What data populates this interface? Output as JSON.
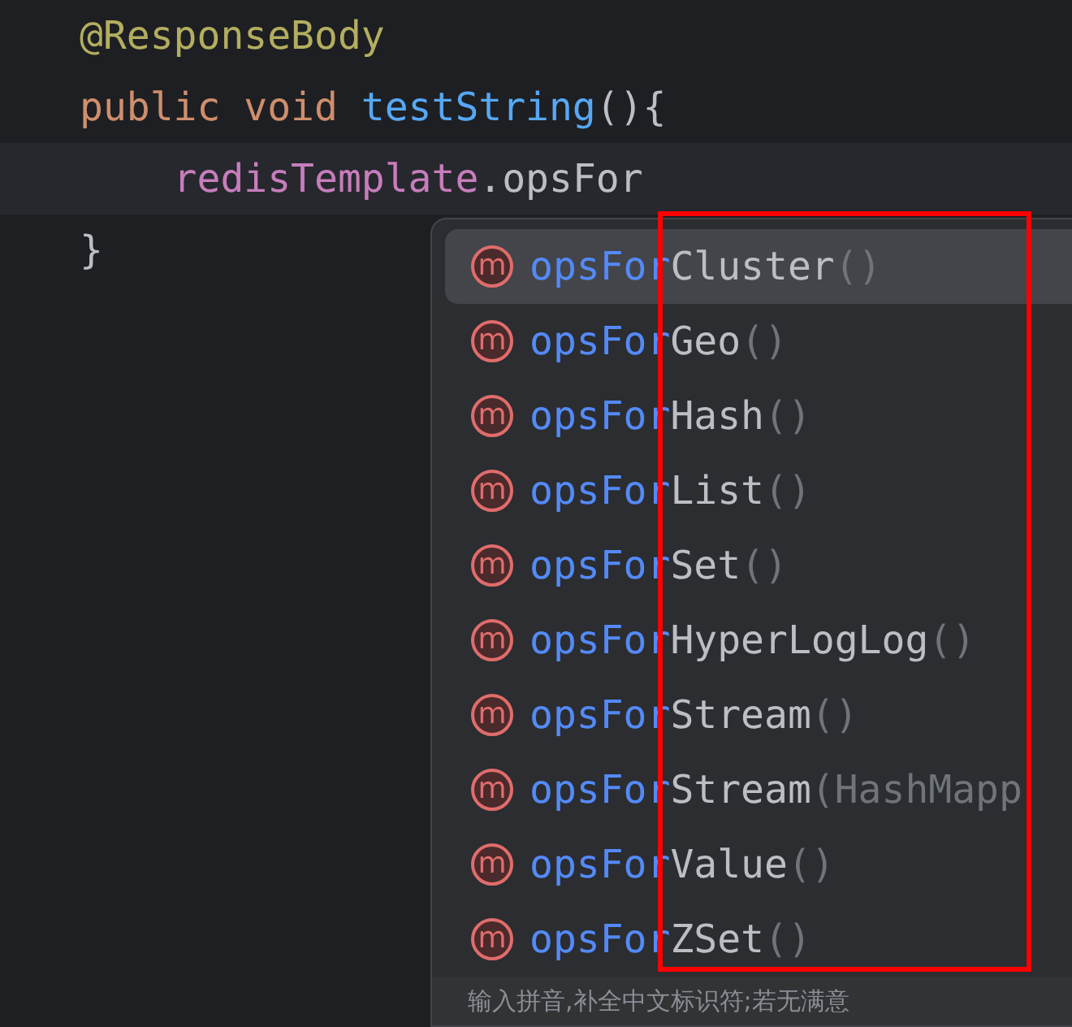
{
  "editor": {
    "lines": [
      {
        "current": false,
        "tokens": [
          {
            "kind": "annotation",
            "text": "@ResponseBody"
          }
        ]
      },
      {
        "current": false,
        "tokens": [
          {
            "kind": "keyword",
            "text": "public void "
          },
          {
            "kind": "method",
            "text": "testString"
          },
          {
            "kind": "plain",
            "text": "(){"
          }
        ]
      },
      {
        "current": true,
        "tokens": [
          {
            "kind": "field",
            "text": "    redisTemplate"
          },
          {
            "kind": "plain",
            "text": ".opsFor"
          }
        ]
      },
      {
        "current": false,
        "tokens": [
          {
            "kind": "plain",
            "text": "}"
          }
        ]
      }
    ]
  },
  "completion": {
    "items": [
      {
        "badge": "m",
        "prefix": "opsFor",
        "rest": "Cluster",
        "params": "()",
        "selected": true
      },
      {
        "badge": "m",
        "prefix": "opsFor",
        "rest": "Geo",
        "params": "()",
        "selected": false
      },
      {
        "badge": "m",
        "prefix": "opsFor",
        "rest": "Hash",
        "params": "()",
        "selected": false
      },
      {
        "badge": "m",
        "prefix": "opsFor",
        "rest": "List",
        "params": "()",
        "selected": false
      },
      {
        "badge": "m",
        "prefix": "opsFor",
        "rest": "Set",
        "params": "()",
        "selected": false
      },
      {
        "badge": "m",
        "prefix": "opsFor",
        "rest": "HyperLogLog",
        "params": "()",
        "selected": false
      },
      {
        "badge": "m",
        "prefix": "opsFor",
        "rest": "Stream",
        "params": "()",
        "selected": false
      },
      {
        "badge": "m",
        "prefix": "opsFor",
        "rest": "Stream",
        "params": "(HashMapp",
        "selected": false
      },
      {
        "badge": "m",
        "prefix": "opsFor",
        "rest": "Value",
        "params": "()",
        "selected": false
      },
      {
        "badge": "m",
        "prefix": "opsFor",
        "rest": "ZSet",
        "params": "()",
        "selected": false
      }
    ],
    "footer": "输入拼音,补全中文标识符;若无满意"
  }
}
